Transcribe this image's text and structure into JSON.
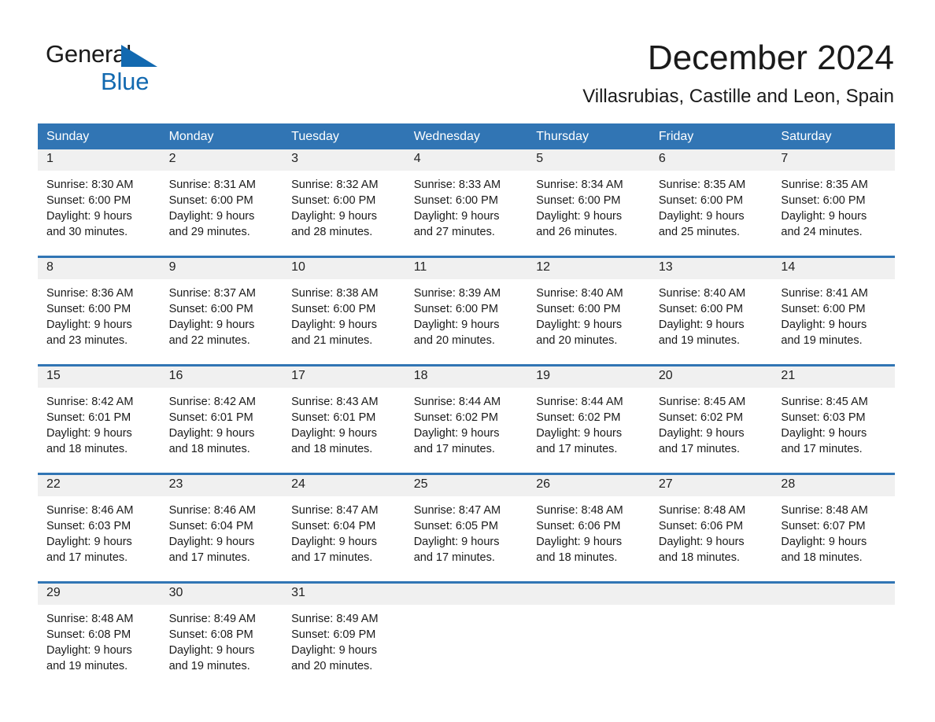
{
  "brand": {
    "name_part1": "General",
    "name_part2": "Blue",
    "triangle_color": "#1269b0"
  },
  "header": {
    "title": "December 2024",
    "subtitle": "Villasrubias, Castille and Leon, Spain"
  },
  "colors": {
    "header_blue": "#3175b4",
    "row_divider_blue": "#3175b4",
    "daynum_strip": "#f0f0f0",
    "text": "#1a1a1a"
  },
  "weekdays": [
    "Sunday",
    "Monday",
    "Tuesday",
    "Wednesday",
    "Thursday",
    "Friday",
    "Saturday"
  ],
  "weeks": [
    [
      {
        "day": "1",
        "sunrise": "Sunrise: 8:30 AM",
        "sunset": "Sunset: 6:00 PM",
        "daylight1": "Daylight: 9 hours",
        "daylight2": "and 30 minutes."
      },
      {
        "day": "2",
        "sunrise": "Sunrise: 8:31 AM",
        "sunset": "Sunset: 6:00 PM",
        "daylight1": "Daylight: 9 hours",
        "daylight2": "and 29 minutes."
      },
      {
        "day": "3",
        "sunrise": "Sunrise: 8:32 AM",
        "sunset": "Sunset: 6:00 PM",
        "daylight1": "Daylight: 9 hours",
        "daylight2": "and 28 minutes."
      },
      {
        "day": "4",
        "sunrise": "Sunrise: 8:33 AM",
        "sunset": "Sunset: 6:00 PM",
        "daylight1": "Daylight: 9 hours",
        "daylight2": "and 27 minutes."
      },
      {
        "day": "5",
        "sunrise": "Sunrise: 8:34 AM",
        "sunset": "Sunset: 6:00 PM",
        "daylight1": "Daylight: 9 hours",
        "daylight2": "and 26 minutes."
      },
      {
        "day": "6",
        "sunrise": "Sunrise: 8:35 AM",
        "sunset": "Sunset: 6:00 PM",
        "daylight1": "Daylight: 9 hours",
        "daylight2": "and 25 minutes."
      },
      {
        "day": "7",
        "sunrise": "Sunrise: 8:35 AM",
        "sunset": "Sunset: 6:00 PM",
        "daylight1": "Daylight: 9 hours",
        "daylight2": "and 24 minutes."
      }
    ],
    [
      {
        "day": "8",
        "sunrise": "Sunrise: 8:36 AM",
        "sunset": "Sunset: 6:00 PM",
        "daylight1": "Daylight: 9 hours",
        "daylight2": "and 23 minutes."
      },
      {
        "day": "9",
        "sunrise": "Sunrise: 8:37 AM",
        "sunset": "Sunset: 6:00 PM",
        "daylight1": "Daylight: 9 hours",
        "daylight2": "and 22 minutes."
      },
      {
        "day": "10",
        "sunrise": "Sunrise: 8:38 AM",
        "sunset": "Sunset: 6:00 PM",
        "daylight1": "Daylight: 9 hours",
        "daylight2": "and 21 minutes."
      },
      {
        "day": "11",
        "sunrise": "Sunrise: 8:39 AM",
        "sunset": "Sunset: 6:00 PM",
        "daylight1": "Daylight: 9 hours",
        "daylight2": "and 20 minutes."
      },
      {
        "day": "12",
        "sunrise": "Sunrise: 8:40 AM",
        "sunset": "Sunset: 6:00 PM",
        "daylight1": "Daylight: 9 hours",
        "daylight2": "and 20 minutes."
      },
      {
        "day": "13",
        "sunrise": "Sunrise: 8:40 AM",
        "sunset": "Sunset: 6:00 PM",
        "daylight1": "Daylight: 9 hours",
        "daylight2": "and 19 minutes."
      },
      {
        "day": "14",
        "sunrise": "Sunrise: 8:41 AM",
        "sunset": "Sunset: 6:00 PM",
        "daylight1": "Daylight: 9 hours",
        "daylight2": "and 19 minutes."
      }
    ],
    [
      {
        "day": "15",
        "sunrise": "Sunrise: 8:42 AM",
        "sunset": "Sunset: 6:01 PM",
        "daylight1": "Daylight: 9 hours",
        "daylight2": "and 18 minutes."
      },
      {
        "day": "16",
        "sunrise": "Sunrise: 8:42 AM",
        "sunset": "Sunset: 6:01 PM",
        "daylight1": "Daylight: 9 hours",
        "daylight2": "and 18 minutes."
      },
      {
        "day": "17",
        "sunrise": "Sunrise: 8:43 AM",
        "sunset": "Sunset: 6:01 PM",
        "daylight1": "Daylight: 9 hours",
        "daylight2": "and 18 minutes."
      },
      {
        "day": "18",
        "sunrise": "Sunrise: 8:44 AM",
        "sunset": "Sunset: 6:02 PM",
        "daylight1": "Daylight: 9 hours",
        "daylight2": "and 17 minutes."
      },
      {
        "day": "19",
        "sunrise": "Sunrise: 8:44 AM",
        "sunset": "Sunset: 6:02 PM",
        "daylight1": "Daylight: 9 hours",
        "daylight2": "and 17 minutes."
      },
      {
        "day": "20",
        "sunrise": "Sunrise: 8:45 AM",
        "sunset": "Sunset: 6:02 PM",
        "daylight1": "Daylight: 9 hours",
        "daylight2": "and 17 minutes."
      },
      {
        "day": "21",
        "sunrise": "Sunrise: 8:45 AM",
        "sunset": "Sunset: 6:03 PM",
        "daylight1": "Daylight: 9 hours",
        "daylight2": "and 17 minutes."
      }
    ],
    [
      {
        "day": "22",
        "sunrise": "Sunrise: 8:46 AM",
        "sunset": "Sunset: 6:03 PM",
        "daylight1": "Daylight: 9 hours",
        "daylight2": "and 17 minutes."
      },
      {
        "day": "23",
        "sunrise": "Sunrise: 8:46 AM",
        "sunset": "Sunset: 6:04 PM",
        "daylight1": "Daylight: 9 hours",
        "daylight2": "and 17 minutes."
      },
      {
        "day": "24",
        "sunrise": "Sunrise: 8:47 AM",
        "sunset": "Sunset: 6:04 PM",
        "daylight1": "Daylight: 9 hours",
        "daylight2": "and 17 minutes."
      },
      {
        "day": "25",
        "sunrise": "Sunrise: 8:47 AM",
        "sunset": "Sunset: 6:05 PM",
        "daylight1": "Daylight: 9 hours",
        "daylight2": "and 17 minutes."
      },
      {
        "day": "26",
        "sunrise": "Sunrise: 8:48 AM",
        "sunset": "Sunset: 6:06 PM",
        "daylight1": "Daylight: 9 hours",
        "daylight2": "and 18 minutes."
      },
      {
        "day": "27",
        "sunrise": "Sunrise: 8:48 AM",
        "sunset": "Sunset: 6:06 PM",
        "daylight1": "Daylight: 9 hours",
        "daylight2": "and 18 minutes."
      },
      {
        "day": "28",
        "sunrise": "Sunrise: 8:48 AM",
        "sunset": "Sunset: 6:07 PM",
        "daylight1": "Daylight: 9 hours",
        "daylight2": "and 18 minutes."
      }
    ],
    [
      {
        "day": "29",
        "sunrise": "Sunrise: 8:48 AM",
        "sunset": "Sunset: 6:08 PM",
        "daylight1": "Daylight: 9 hours",
        "daylight2": "and 19 minutes."
      },
      {
        "day": "30",
        "sunrise": "Sunrise: 8:49 AM",
        "sunset": "Sunset: 6:08 PM",
        "daylight1": "Daylight: 9 hours",
        "daylight2": "and 19 minutes."
      },
      {
        "day": "31",
        "sunrise": "Sunrise: 8:49 AM",
        "sunset": "Sunset: 6:09 PM",
        "daylight1": "Daylight: 9 hours",
        "daylight2": "and 20 minutes."
      },
      {
        "day": "",
        "sunrise": "",
        "sunset": "",
        "daylight1": "",
        "daylight2": ""
      },
      {
        "day": "",
        "sunrise": "",
        "sunset": "",
        "daylight1": "",
        "daylight2": ""
      },
      {
        "day": "",
        "sunrise": "",
        "sunset": "",
        "daylight1": "",
        "daylight2": ""
      },
      {
        "day": "",
        "sunrise": "",
        "sunset": "",
        "daylight1": "",
        "daylight2": ""
      }
    ]
  ]
}
